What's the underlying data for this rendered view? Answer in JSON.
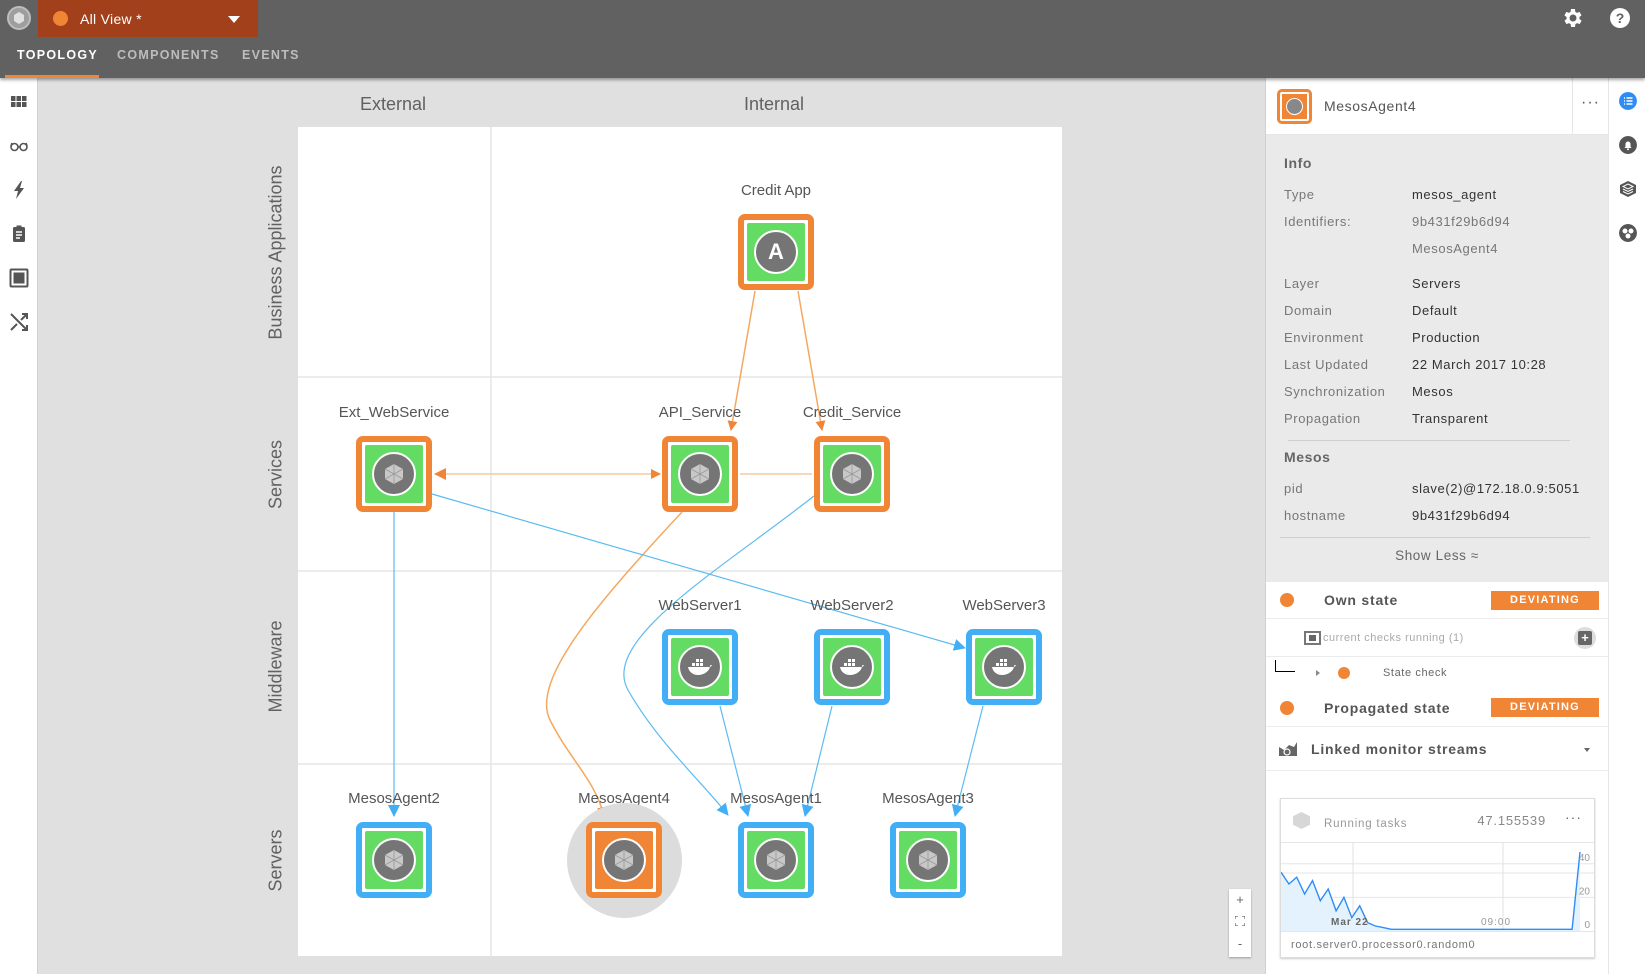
{
  "app": {
    "view_selector": {
      "label": "All View *",
      "status_color": "#f08536"
    },
    "tabs": [
      {
        "label": "TOPOLOGY",
        "active": true
      },
      {
        "label": "COMPONENTS",
        "active": false
      },
      {
        "label": "EVENTS",
        "active": false
      }
    ],
    "top_icons": [
      "gear-icon",
      "help-icon"
    ]
  },
  "left_rail": {
    "items": [
      "grid-icon",
      "glasses-icon",
      "lightning-icon",
      "clipboard-icon",
      "square-icon",
      "shuffle-icon"
    ]
  },
  "topology": {
    "columns": [
      "External",
      "Internal"
    ],
    "rows": [
      "Business Applications",
      "Services",
      "Middleware",
      "Servers"
    ],
    "nodes": [
      {
        "id": "credit_app",
        "label": "Credit App",
        "state": "deviating",
        "icon": "A",
        "type": "application"
      },
      {
        "id": "ext_webservice",
        "label": "Ext_WebService",
        "state": "deviating",
        "icon": "mesos",
        "type": "service"
      },
      {
        "id": "api_service",
        "label": "API_Service",
        "state": "deviating",
        "icon": "mesos",
        "type": "service"
      },
      {
        "id": "credit_service",
        "label": "Credit_Service",
        "state": "deviating",
        "icon": "mesos",
        "type": "service"
      },
      {
        "id": "webserver1",
        "label": "WebServer1",
        "state": "clear",
        "icon": "docker",
        "type": "middleware"
      },
      {
        "id": "webserver2",
        "label": "WebServer2",
        "state": "clear",
        "icon": "docker",
        "type": "middleware"
      },
      {
        "id": "webserver3",
        "label": "WebServer3",
        "state": "clear",
        "icon": "docker",
        "type": "middleware"
      },
      {
        "id": "mesosagent2",
        "label": "MesosAgent2",
        "state": "clear",
        "icon": "mesos",
        "type": "server"
      },
      {
        "id": "mesosagent4",
        "label": "MesosAgent4",
        "state": "deviating",
        "icon": "mesos",
        "type": "server",
        "selected": true
      },
      {
        "id": "mesosagent1",
        "label": "MesosAgent1",
        "state": "clear",
        "icon": "mesos",
        "type": "server"
      },
      {
        "id": "mesosagent3",
        "label": "MesosAgent3",
        "state": "clear",
        "icon": "mesos",
        "type": "server"
      }
    ],
    "zoom_controls": {
      "in": "+",
      "fit": "⛶",
      "out": "-"
    }
  },
  "details": {
    "title": "MesosAgent4",
    "more": "···",
    "info_title": "Info",
    "info": [
      {
        "key": "Type",
        "value": "mesos_agent"
      },
      {
        "key": "Identifiers:",
        "value": "9b431f29b6d94"
      },
      {
        "key": "",
        "value": "MesosAgent4"
      },
      {
        "key": "Layer",
        "value": "Servers"
      },
      {
        "key": "Domain",
        "value": "Default"
      },
      {
        "key": "Environment",
        "value": "Production"
      },
      {
        "key": "Last Updated",
        "value": "22 March 2017 10:28"
      },
      {
        "key": "Synchronization",
        "value": "Mesos"
      },
      {
        "key": "Propagation",
        "value": "Transparent"
      }
    ],
    "mesos_title": "Mesos",
    "mesos": [
      {
        "key": "pid",
        "value": "slave(2)@172.18.0.9:5051"
      },
      {
        "key": "hostname",
        "value": "9b431f29b6d94"
      }
    ],
    "show_less": "Show Less ≈",
    "own_state": {
      "label": "Own state",
      "badge": "DEVIATING"
    },
    "checks_label": "current checks running (1)",
    "state_check": "State check",
    "propagated_state": {
      "label": "Propagated state",
      "badge": "DEVIATING"
    },
    "linked_streams": "Linked monitor streams",
    "stream": {
      "name": "Running tasks",
      "value": "47.155539",
      "more": "···",
      "query": "root.server0.processor0.random0"
    },
    "state_color": "#f08536"
  },
  "chart_data": {
    "type": "area",
    "title": "Running tasks",
    "x_ticks": [
      "Mar 22",
      "09:00"
    ],
    "y_ticks": [
      0,
      20,
      40
    ],
    "ylim": [
      0,
      50
    ],
    "series": [
      {
        "name": "root.server0.processor0.random0",
        "values": [
          35,
          28,
          32,
          22,
          30,
          18,
          25,
          12,
          20,
          8,
          15,
          5,
          3,
          2,
          1,
          1,
          1,
          1,
          1,
          1,
          1,
          1,
          1,
          1,
          1,
          1,
          1,
          1,
          1,
          1,
          1,
          1,
          1,
          1,
          1,
          1,
          1,
          1,
          47
        ]
      }
    ]
  },
  "right_rail": {
    "items": [
      "list-icon",
      "bell-icon",
      "stack-icon",
      "network-icon"
    ]
  }
}
